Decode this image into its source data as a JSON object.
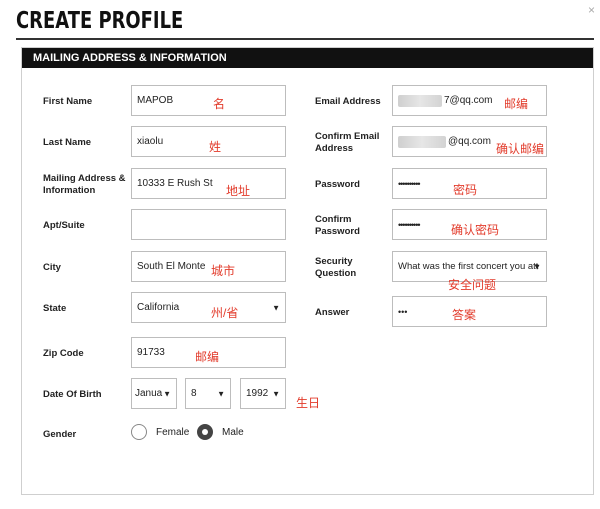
{
  "page": {
    "title": "CREATE PROFILE",
    "close": "×"
  },
  "section": {
    "title": "MAILING ADDRESS & INFORMATION"
  },
  "left": {
    "first_name": {
      "label": "First Name",
      "value": "MAPOB",
      "note": "名"
    },
    "last_name": {
      "label": "Last Name",
      "value": "xiaolu",
      "note": "姓"
    },
    "mailing_address": {
      "label": "Mailing Address & Information",
      "value": "10333 E Rush St",
      "note": "地址"
    },
    "apt_suite": {
      "label": "Apt/Suite",
      "value": ""
    },
    "city": {
      "label": "City",
      "value": "South El Monte",
      "note": "城市"
    },
    "state": {
      "label": "State",
      "value": "California",
      "note": "州/省"
    },
    "zip_code": {
      "label": "Zip Code",
      "value": "91733",
      "note": "邮编"
    },
    "dob": {
      "label": "Date Of Birth",
      "month": "Janua",
      "day": "8",
      "year": "1992",
      "note": "生日"
    },
    "gender": {
      "label": "Gender",
      "female": "Female",
      "male": "Male",
      "selected": "Male"
    }
  },
  "right": {
    "email": {
      "label": "Email Address",
      "value": "7@qq.com",
      "note": "邮编"
    },
    "confirm_email": {
      "label": "Confirm Email Address",
      "value": "@qq.com",
      "note": "确认邮编"
    },
    "password": {
      "label": "Password",
      "value": "••••••••••",
      "note": "密码"
    },
    "confirm_password": {
      "label": "Confirm Password",
      "value": "••••••••••",
      "note": "确认密码"
    },
    "security_question": {
      "label": "Security Question",
      "value": "What was the first concert you att",
      "note": "安全问题"
    },
    "answer": {
      "label": "Answer",
      "value": "•••",
      "note": "答案"
    }
  }
}
